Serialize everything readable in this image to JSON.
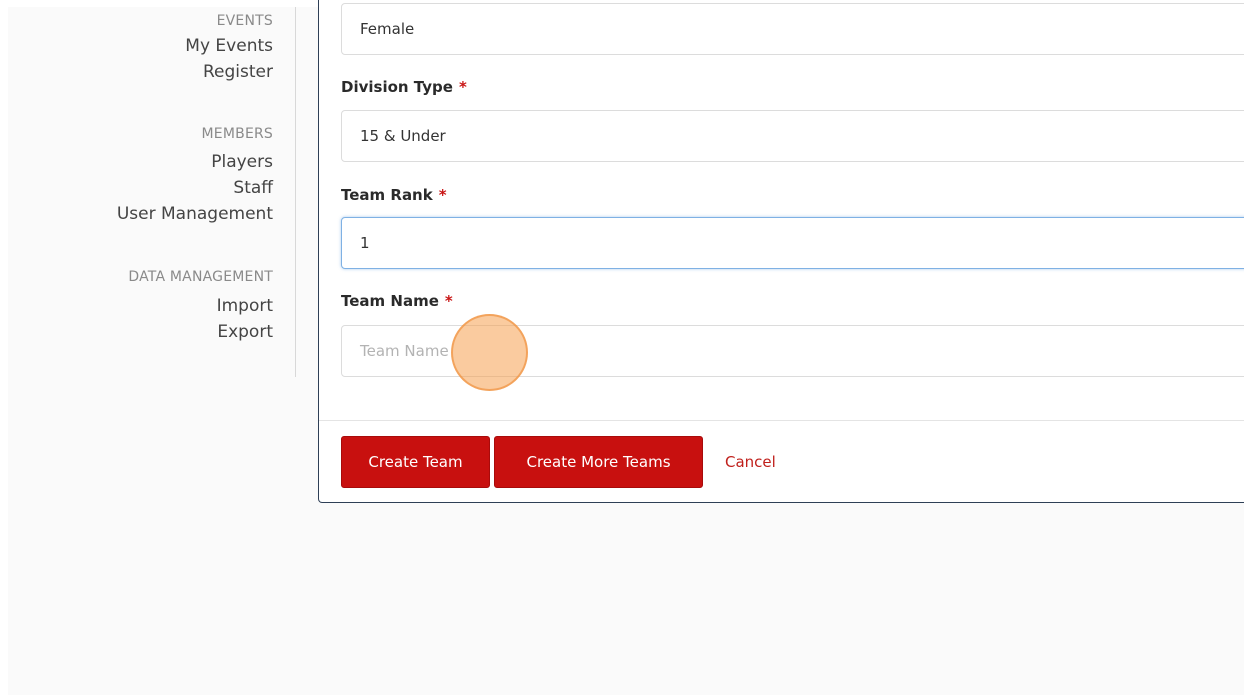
{
  "sidebar": {
    "events_heading": "EVENTS",
    "events_items": [
      "My Events",
      "Register"
    ],
    "members_heading": "MEMBERS",
    "members_items": [
      "Players",
      "Staff",
      "User Management"
    ],
    "data_heading": "DATA MANAGEMENT",
    "data_items": [
      "Import",
      "Export"
    ]
  },
  "form": {
    "gender_value": "Female",
    "division_label": "Division Type",
    "division_value": "15 & Under",
    "rank_label": "Team Rank",
    "rank_value": "1",
    "name_label": "Team Name",
    "name_placeholder": "Team Name",
    "required_marker": "*"
  },
  "actions": {
    "create_team": "Create Team",
    "create_more": "Create More Teams",
    "cancel": "Cancel"
  },
  "colors": {
    "primary_button": "#c8100f",
    "cancel_link": "#c0201c",
    "required_marker": "#c91515",
    "focus_border": "#7fb1e4"
  }
}
